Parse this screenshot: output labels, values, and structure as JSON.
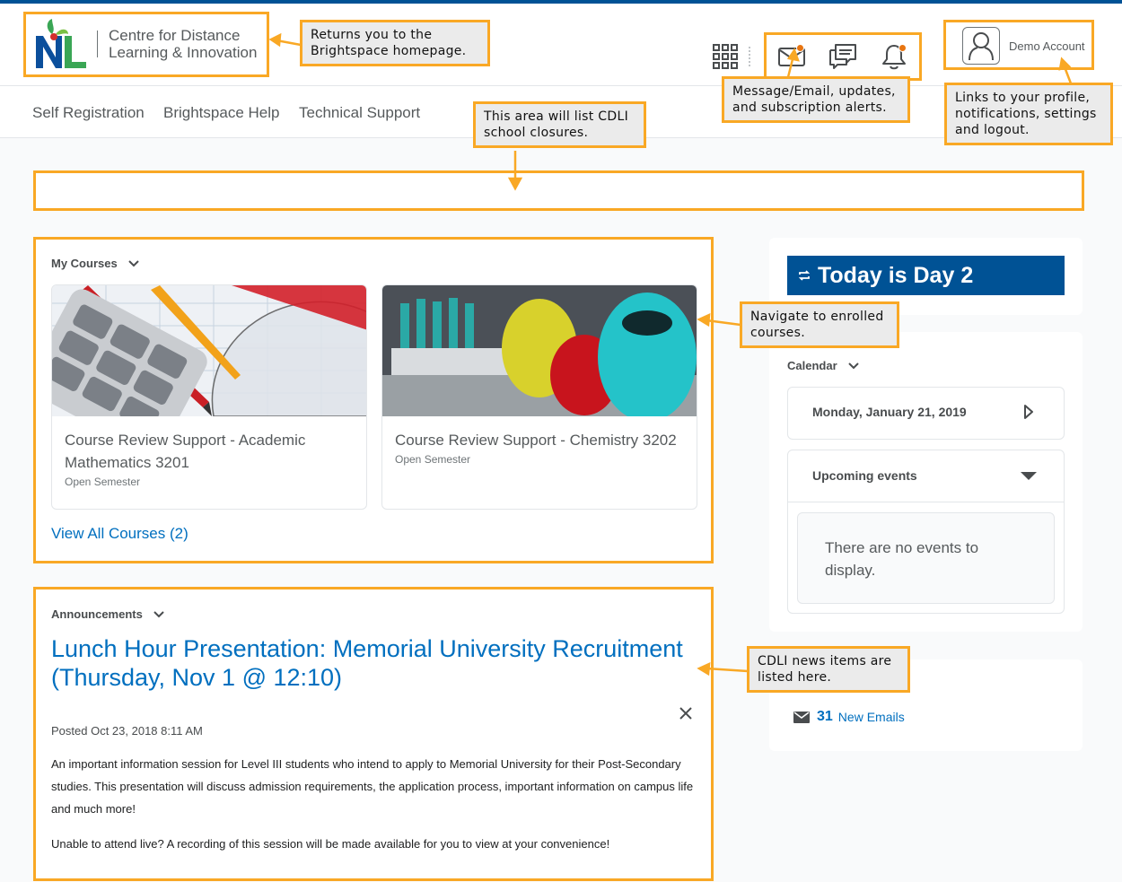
{
  "header": {
    "org_line1": "Centre for Distance",
    "org_line2": "Learning & Innovation",
    "account_name": "Demo Account"
  },
  "nav": {
    "items": [
      {
        "label": "Self Registration"
      },
      {
        "label": "Brightspace Help"
      },
      {
        "label": "Technical Support"
      }
    ]
  },
  "my_courses": {
    "title": "My Courses",
    "courses": [
      {
        "name": "Course Review Support - Academic Mathematics 3201",
        "semester": "Open Semester"
      },
      {
        "name": "Course Review Support - Chemistry 3202",
        "semester": "Open Semester"
      }
    ],
    "view_all": "View All Courses (2)"
  },
  "announcements": {
    "title": "Announcements",
    "headline": "Lunch Hour Presentation: Memorial University Recruitment (Thursday, Nov 1 @ 12:10)",
    "posted": "Posted Oct 23, 2018 8:11 AM",
    "body1": "An important information session for Level III students who intend to apply to Memorial University for their Post-Secondary studies. This presentation will discuss admission requirements, the application process, important information on campus life and much more!",
    "body2": "Unable to attend live? A recording of this session will be made available for you to view at your convenience!"
  },
  "sidebar": {
    "today": "Today is Day 2",
    "calendar_title": "Calendar",
    "date": "Monday, January 21, 2019",
    "upcoming_title": "Upcoming events",
    "no_events": "There are no events to display.",
    "email_count": "31",
    "email_label": "New Emails"
  },
  "callouts": {
    "home": "Returns you to the Brightspace homepage.",
    "alerts": "Message/Email, updates, and subscription alerts.",
    "profile": "Links to your profile, notifications, settings and logout.",
    "closures": "This area will list CDLI school closures.",
    "courses": "Navigate to enrolled courses.",
    "news": "CDLI news items are listed here."
  },
  "colors": {
    "brand_blue": "#005295",
    "link_blue": "#006fbf",
    "highlight": "#f9a825",
    "alert_dot": "#e87511"
  }
}
